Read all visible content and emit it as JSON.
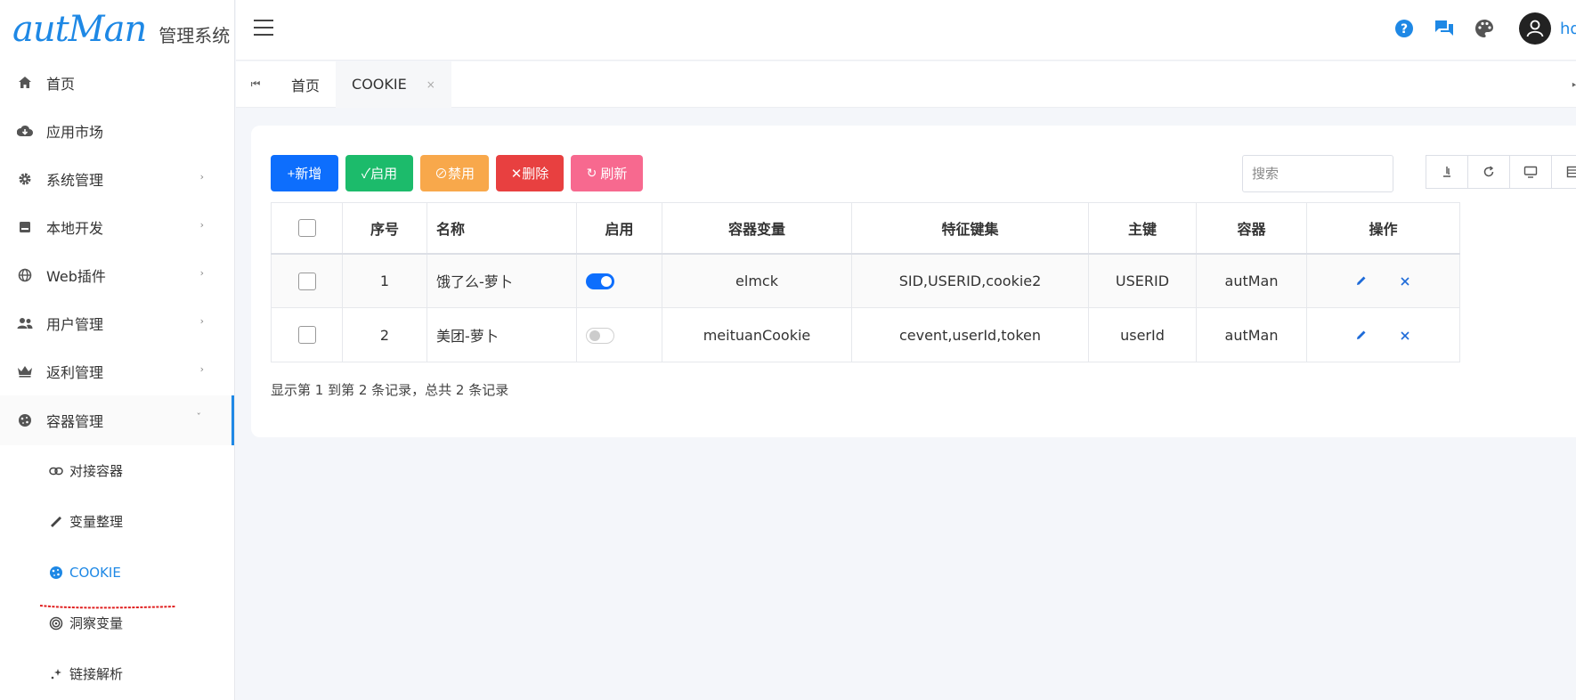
{
  "brand": {
    "logo": "autMan",
    "subtitle": "管理系统"
  },
  "sidebar": {
    "items": [
      {
        "label": "首页",
        "icon": "home-icon",
        "has_children": false
      },
      {
        "label": "应用市场",
        "icon": "cloud-download-icon",
        "has_children": false
      },
      {
        "label": "系统管理",
        "icon": "gear-icon",
        "has_children": true
      },
      {
        "label": "本地开发",
        "icon": "archive-icon",
        "has_children": true
      },
      {
        "label": "Web插件",
        "icon": "globe-icon",
        "has_children": true
      },
      {
        "label": "用户管理",
        "icon": "users-icon",
        "has_children": true
      },
      {
        "label": "返利管理",
        "icon": "crown-icon",
        "has_children": true
      },
      {
        "label": "容器管理",
        "icon": "cookie-icon",
        "has_children": true,
        "expanded": true
      }
    ],
    "subitems": [
      {
        "label": "对接容器",
        "icon": "link-icon"
      },
      {
        "label": "变量整理",
        "icon": "ruler-icon"
      },
      {
        "label": "COOKIE",
        "icon": "cookie-icon",
        "active": true
      },
      {
        "label": "洞察变量",
        "icon": "target-icon"
      },
      {
        "label": "链接解析",
        "icon": "sparkle-icon"
      }
    ]
  },
  "header": {
    "user_label": "hd"
  },
  "tabs": [
    {
      "label": "首页",
      "active": false
    },
    {
      "label": "COOKIE",
      "active": true,
      "close": "×"
    }
  ],
  "toolbar": {
    "add_label": "+新增",
    "enable_label": "✓启用",
    "disable_label": "⊘禁用",
    "delete_label": "✕删除",
    "refresh_label": "刷新"
  },
  "search": {
    "placeholder": "搜索",
    "value": ""
  },
  "table": {
    "columns": [
      "序号",
      "名称",
      "启用",
      "容器变量",
      "特征键集",
      "主键",
      "容器",
      "操作"
    ],
    "rows": [
      {
        "index": "1",
        "name": "饿了么-萝卜",
        "enabled": true,
        "var": "elmck",
        "keys": "SID,USERID,cookie2",
        "pk": "USERID",
        "container": "autMan"
      },
      {
        "index": "2",
        "name": "美团-萝卜",
        "enabled": false,
        "var": "meituanCookie",
        "keys": "cevent,userId,token",
        "pk": "userId",
        "container": "autMan"
      }
    ]
  },
  "pagination": {
    "summary": "显示第 1 到第 2 条记录，总共 2 条记录"
  },
  "colors": {
    "accent": "#1e88e5",
    "primary": "#0d6efd",
    "success": "#1cbb6b",
    "warning": "#f8a84b",
    "danger": "#e84040",
    "pink": "#f7698f",
    "annotation_red": "#e02020"
  }
}
